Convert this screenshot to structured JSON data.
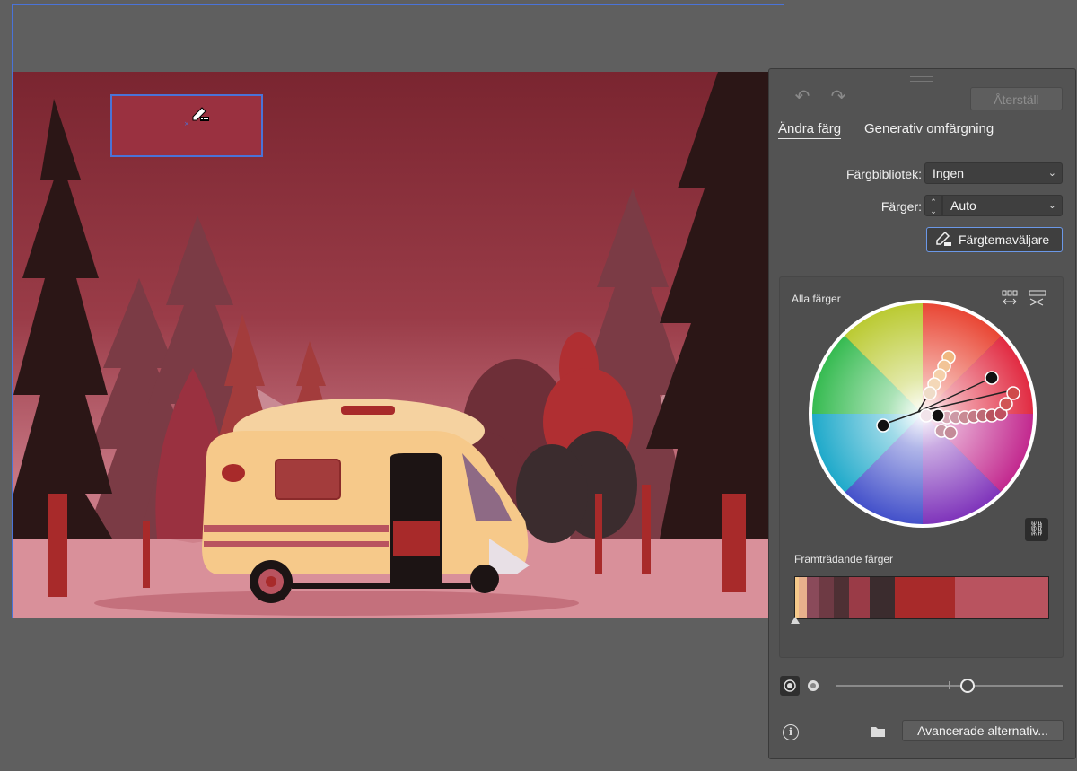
{
  "panel": {
    "undo_icon": "undo-icon",
    "redo_icon": "redo-icon",
    "reset_label": "Återställ",
    "tabs": [
      {
        "label": "Ändra färg",
        "active": true
      },
      {
        "label": "Generativ omfärgning",
        "active": false
      }
    ],
    "library_label": "Färgbibliotek:",
    "library_value": "Ingen",
    "colors_label": "Färger:",
    "colors_value": "Auto",
    "theme_picker_label": "Färgtemaväljare",
    "wheel_section_title": "Alla färger",
    "prominent_title": "Framträdande färger",
    "prominent_colors": [
      {
        "color": "#f6c98a",
        "share": 1.5
      },
      {
        "color": "#e8b08c",
        "share": 3
      },
      {
        "color": "#8a4a5a",
        "share": 5
      },
      {
        "color": "#6e3a44",
        "share": 6
      },
      {
        "color": "#4e3034",
        "share": 6
      },
      {
        "color": "#9a3b47",
        "share": 8
      },
      {
        "color": "#3b2c2e",
        "share": 10
      },
      {
        "color": "#a82a2a",
        "share": 24
      },
      {
        "color": "#b9535f",
        "share": 37
      }
    ],
    "advanced_label": "Avancerade alternativ...",
    "slider_value": 0.58
  },
  "accent": "#4a73d8"
}
